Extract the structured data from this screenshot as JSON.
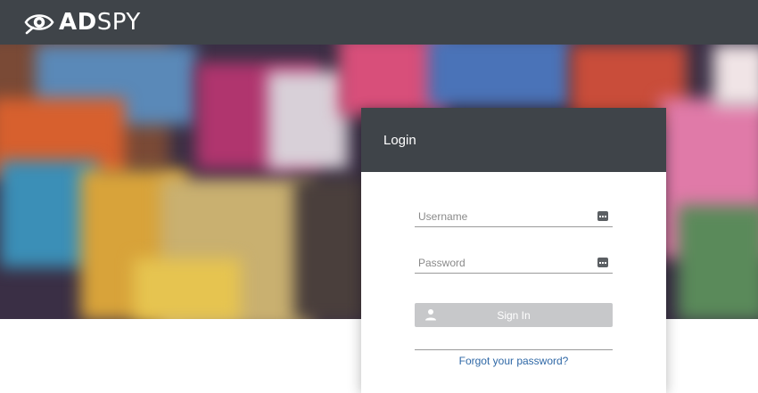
{
  "header": {
    "brand_bold": "AD",
    "brand_thin": "SPY"
  },
  "login": {
    "title": "Login",
    "username_placeholder": "Username",
    "password_placeholder": "Password",
    "signin_label": "Sign In",
    "forgot_label": "Forgot your password?"
  },
  "colors": {
    "header_bg": "#3f4449",
    "button_bg": "#c7c8ca",
    "link": "#2f68a6"
  },
  "icons": {
    "logo": "eye-icon",
    "field_badge": "password-manager-icon",
    "signin": "user-icon"
  }
}
